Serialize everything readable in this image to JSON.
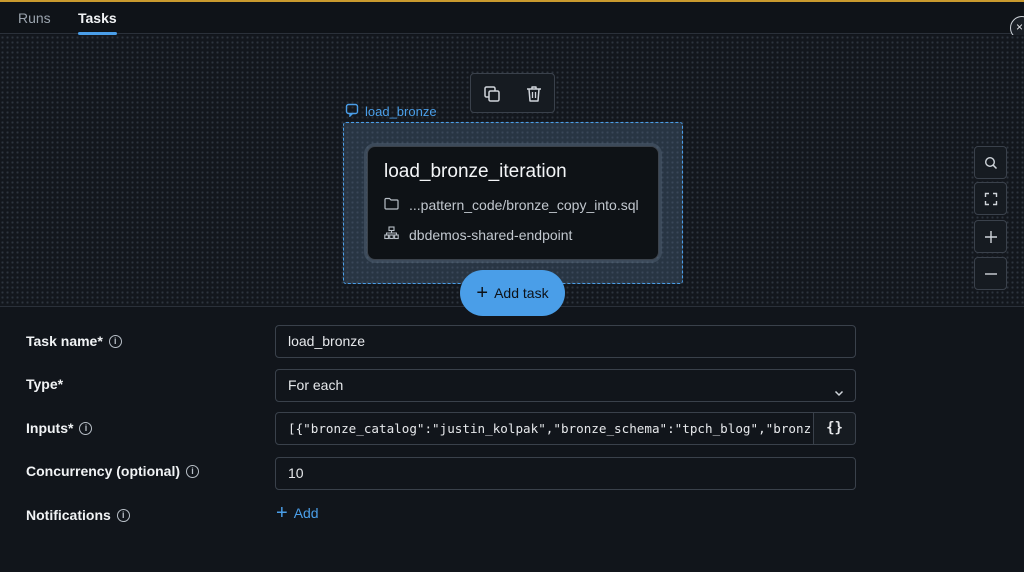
{
  "tabs": {
    "runs": "Runs",
    "tasks": "Tasks"
  },
  "close_symbol": "×",
  "canvas": {
    "group_label": "load_bronze",
    "task_card": {
      "title": "load_bronze_iteration",
      "path": "...pattern_code/bronze_copy_into.sql",
      "endpoint": "dbdemos-shared-endpoint"
    },
    "add_task_label": "Add task",
    "zoom_controls": [
      "search-icon",
      "fit-view-icon",
      "zoom-in-icon",
      "zoom-out-icon"
    ]
  },
  "form": {
    "task_name": {
      "label": "Task name*",
      "value": "load_bronze"
    },
    "type": {
      "label": "Type*",
      "value": "For each"
    },
    "inputs": {
      "label": "Inputs*",
      "value": "[{\"bronze_catalog\":\"justin_kolpak\",\"bronze_schema\":\"tpch_blog\",\"bronz",
      "json_button": "{}"
    },
    "concurrency": {
      "label": "Concurrency (optional)",
      "value": "10"
    },
    "notifications": {
      "label": "Notifications",
      "add_label": "Add"
    }
  },
  "colors": {
    "accent": "#4a9ee8",
    "top_line": "#c99a2e",
    "background": "#11151b"
  }
}
